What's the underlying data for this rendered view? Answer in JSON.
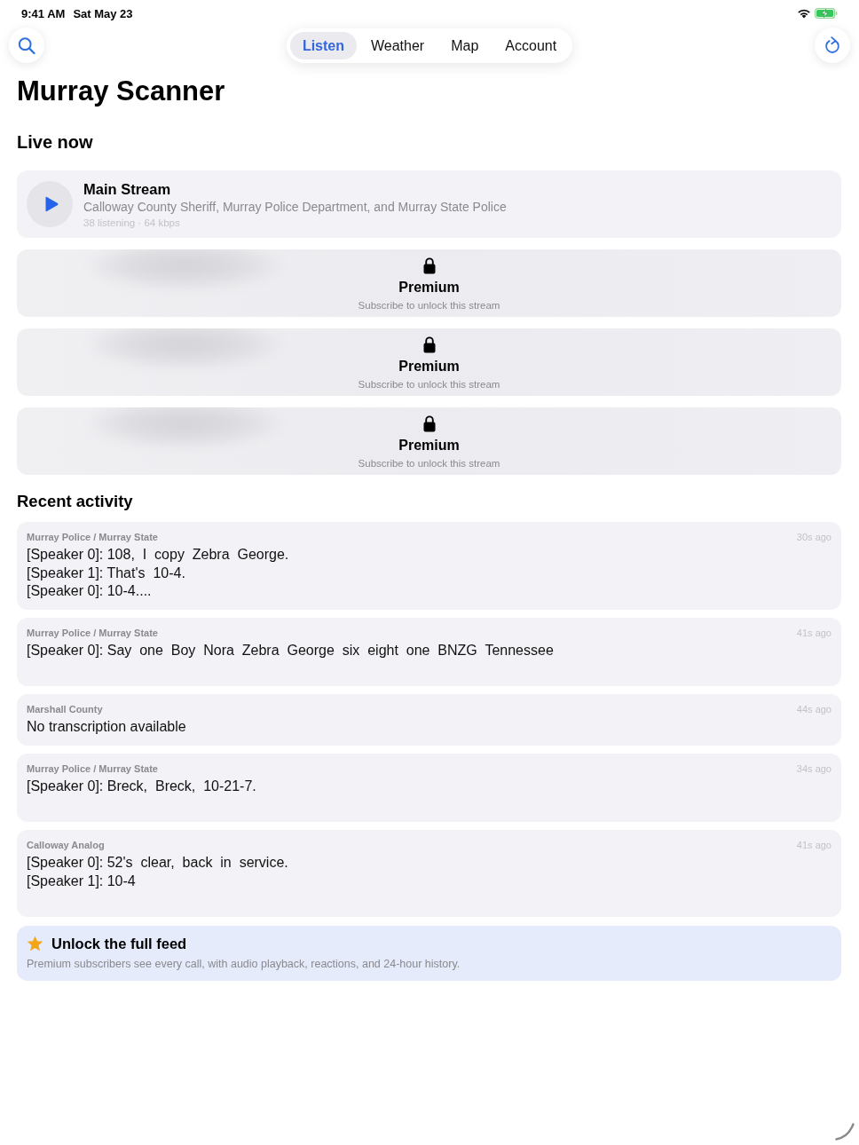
{
  "status_bar": {
    "time": "9:41 AM",
    "date": "Sat May 23"
  },
  "tabs": [
    {
      "label": "Listen",
      "selected": true
    },
    {
      "label": "Weather",
      "selected": false
    },
    {
      "label": "Map",
      "selected": false
    },
    {
      "label": "Account",
      "selected": false
    }
  ],
  "title": "Murray Scanner",
  "live_now": {
    "heading": "Live now",
    "streams": [
      {
        "kind": "live",
        "name": "Main Stream",
        "description": "Calloway County Sheriff, Murray Police Department, and Murray State Police",
        "meta": "38 listening · 64 kbps"
      },
      {
        "kind": "locked",
        "title": "Premium",
        "subtitle": "Subscribe to unlock this stream"
      },
      {
        "kind": "locked",
        "title": "Premium",
        "subtitle": "Subscribe to unlock this stream"
      },
      {
        "kind": "locked",
        "title": "Premium",
        "subtitle": "Subscribe to unlock this stream"
      }
    ]
  },
  "recent_activity": {
    "heading": "Recent activity",
    "items": [
      {
        "kind": "transcript",
        "source": "Murray Police / Murray State",
        "time": "30s ago",
        "lines": [
          "[Speaker 0]: 108,  I  copy  Zebra  George.",
          "[Speaker 1]: That's  10-4.",
          "[Speaker 0]: 10-4...."
        ]
      },
      {
        "kind": "transcript",
        "source": "Murray Police / Murray State",
        "time": "41s ago",
        "lines": [
          "[Speaker 0]: Say  one  Boy  Nora  Zebra  George  six  eight  one  BNZG  Tennessee"
        ]
      },
      {
        "kind": "empty",
        "source": "Marshall County",
        "time": "44s ago",
        "lines": [
          "No transcription available"
        ]
      },
      {
        "kind": "transcript",
        "source": "Murray Police / Murray State",
        "time": "34s ago",
        "lines": [
          "[Speaker 0]: Breck,  Breck,  10-21-7."
        ]
      },
      {
        "kind": "transcript",
        "source": "Calloway Analog",
        "time": "41s ago",
        "lines": [
          "[Speaker 0]: 52's  clear,  back  in  service.",
          "[Speaker 1]: 10-4"
        ]
      }
    ]
  },
  "upsell": {
    "title": "Unlock the full feed",
    "text": "Premium subscribers see every call, with audio playback, reactions, and 24-hour history."
  }
}
